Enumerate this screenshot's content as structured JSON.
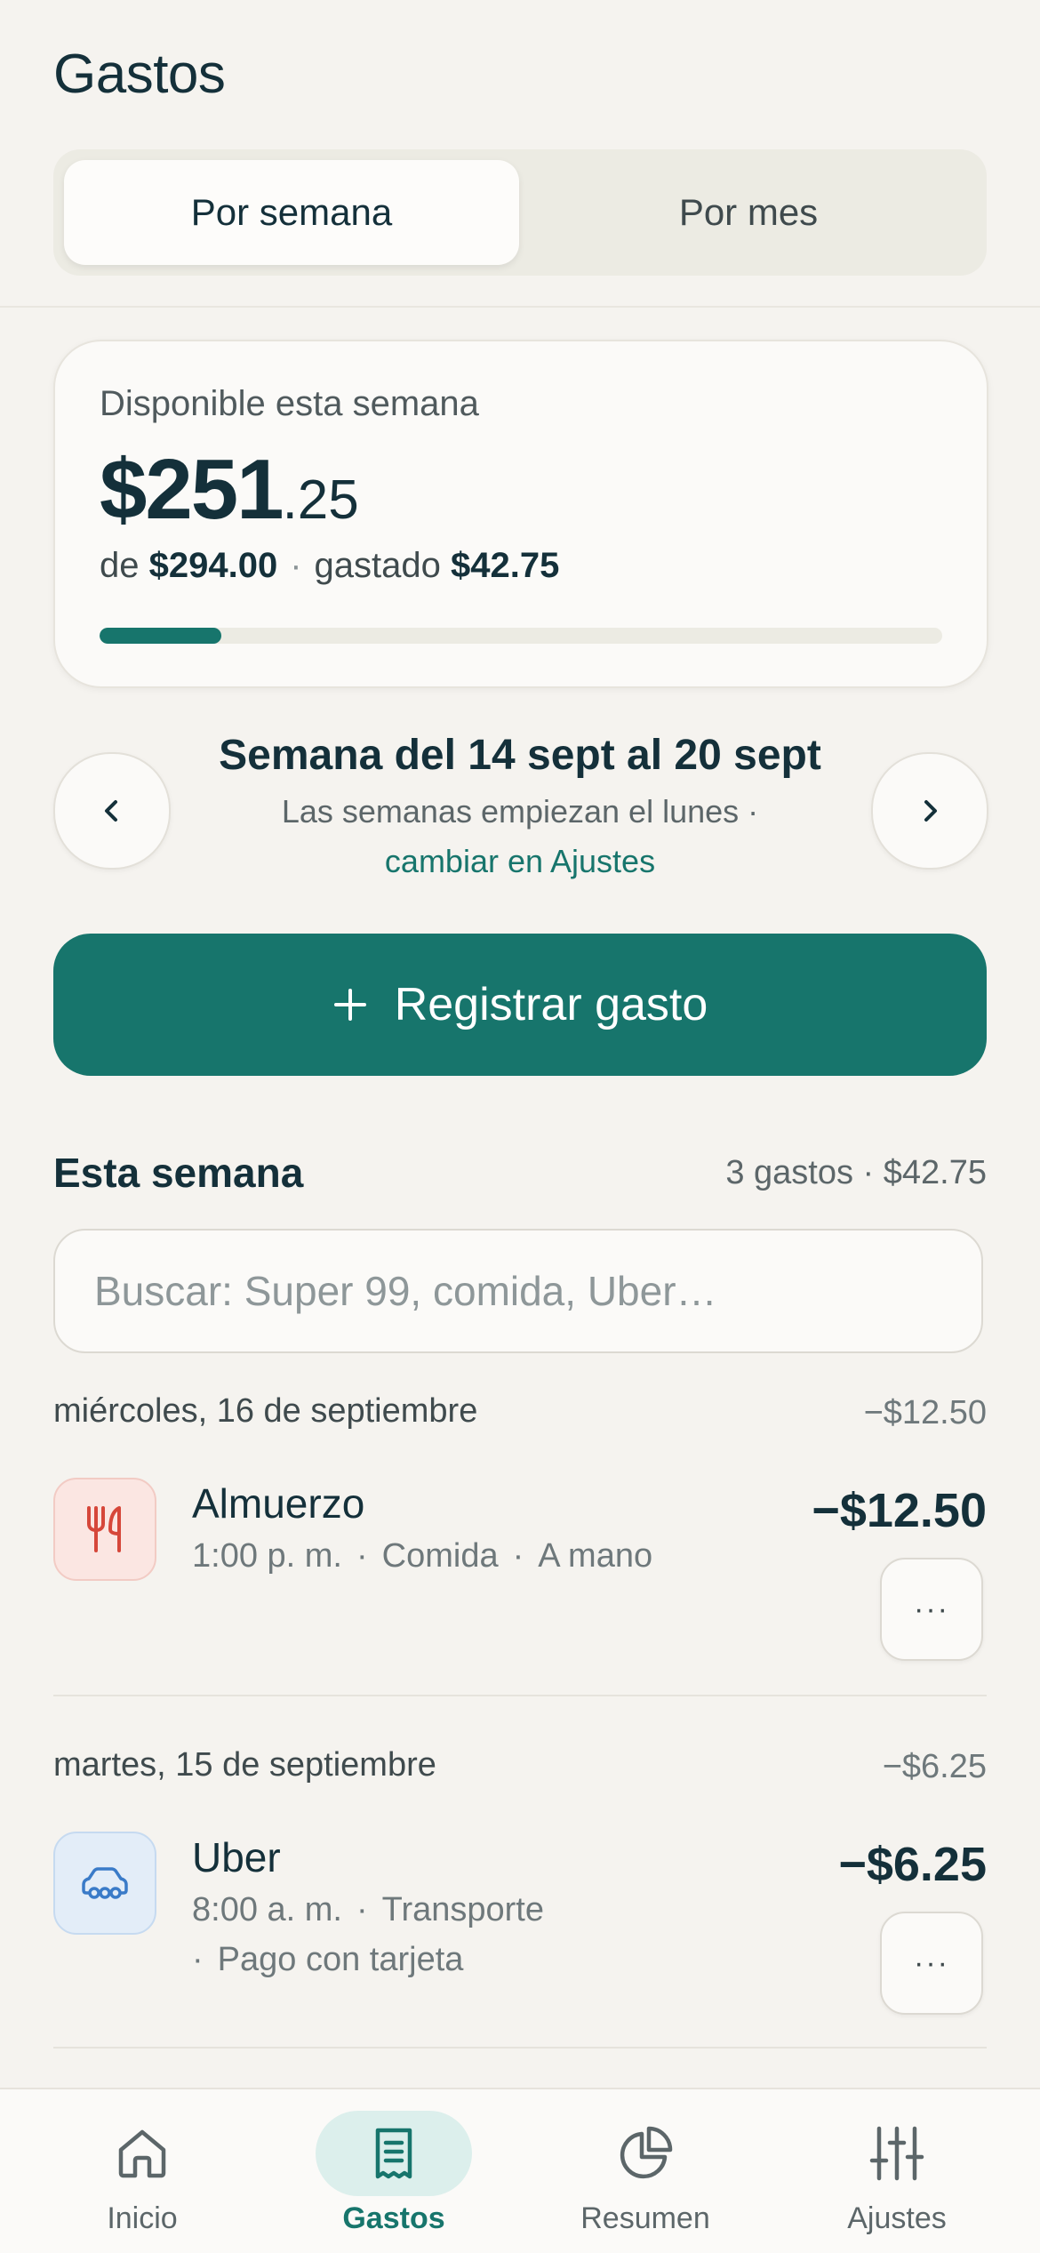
{
  "header": {
    "title": "Gastos",
    "segments": {
      "week": "Por semana",
      "month": "Por mes",
      "selected": "Por semana"
    }
  },
  "summary": {
    "label": "Disponible esta semana",
    "amount_main": "$251",
    "amount_cents": ".25",
    "of_prefix": "de",
    "budget": "$294.00",
    "spent_prefix": "gastado",
    "spent": "$42.75",
    "separator": "·",
    "spent_fraction": 0.145
  },
  "week": {
    "title": "Semana del 14 sept al 20 sept",
    "hint": "Las semanas empiezan el lunes ·",
    "link": "cambiar en Ajustes"
  },
  "actions": {
    "register_label": "Registrar gasto"
  },
  "section": {
    "title": "Esta semana",
    "meta": "3 gastos · $42.75"
  },
  "search": {
    "placeholder": "Buscar: Super 99, comida, Uber…",
    "value": ""
  },
  "days": [
    {
      "label": "miércoles, 16 de septiembre",
      "total": "−$12.50",
      "expenses": [
        {
          "name": "Almuerzo",
          "time": "1:00 p. m.",
          "category": "Comida",
          "method": "A mano",
          "amount": "−$12.50",
          "icon": "fork-knife-icon"
        }
      ]
    },
    {
      "label": "martes, 15 de septiembre",
      "total": "−$6.25",
      "expenses": [
        {
          "name": "Uber",
          "time": "8:00 a. m.",
          "category": "Transporte",
          "method": "Pago con tarjeta",
          "amount": "−$6.25",
          "icon": "car-icon"
        }
      ]
    }
  ],
  "more_glyph": "···",
  "tabs": [
    {
      "label": "Inicio",
      "icon": "home-icon"
    },
    {
      "label": "Gastos",
      "icon": "receipt-icon",
      "active": true
    },
    {
      "label": "Resumen",
      "icon": "pie-chart-icon"
    },
    {
      "label": "Ajustes",
      "icon": "sliders-icon"
    }
  ],
  "colors": {
    "accent": "#17756c",
    "background": "#f5f3ef",
    "text": "#14303a"
  }
}
